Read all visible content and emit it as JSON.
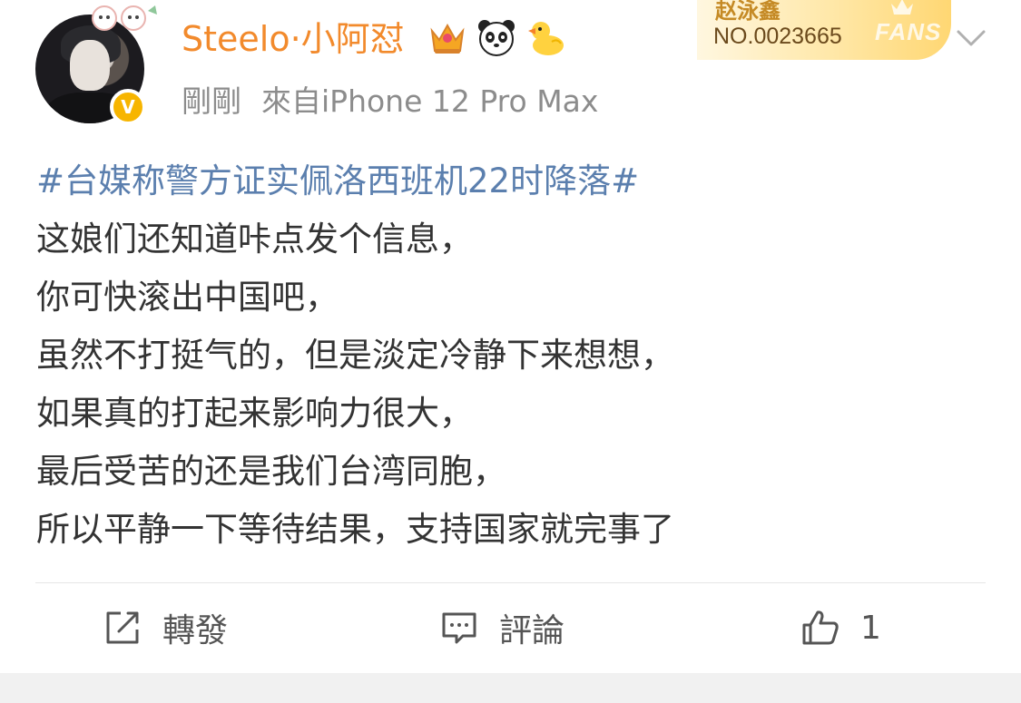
{
  "post": {
    "author": {
      "name": "Steelo·小阿怼",
      "avatar_icon": "user-avatar",
      "verified_icon": "verified-v-badge",
      "verified_mark": "V",
      "badges": [
        "crown-badge-icon",
        "panda-icon",
        "duck-icon"
      ]
    },
    "meta": {
      "time": "剛剛",
      "source": "來自iPhone 12 Pro Max"
    },
    "fan_card": {
      "name": "赵泳鑫",
      "number": "NO.0023665",
      "label": "FANS"
    },
    "content": {
      "hashtag": "#台媒称警方证实佩洛西班机22时降落#",
      "lines": [
        "这娘们还知道咔点发个信息，",
        "你可快滚出中国吧，",
        "虽然不打挺气的，但是淡定冷静下来想想，",
        "如果真的打起来影响力很大，",
        "最后受苦的还是我们台湾同胞，",
        "所以平静一下等待结果，支持国家就完事了"
      ]
    },
    "actions": {
      "repost_label": "轉發",
      "comment_label": "評論",
      "like_count": "1"
    }
  },
  "colors": {
    "username": "#f28a2c",
    "hashtag": "#5b7fae",
    "text": "#333333",
    "meta": "#8c8c8c",
    "verified": "#f7b500"
  }
}
